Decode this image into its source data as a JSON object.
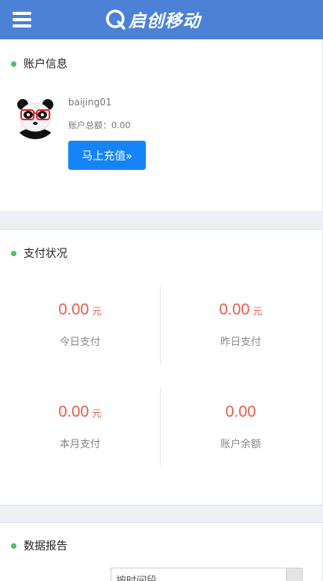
{
  "header": {
    "logo_text": "启创移动",
    "menu_icon": "hamburger-menu-icon",
    "brand_color": "#4c82d6"
  },
  "account": {
    "title": "账户信息",
    "username": "baijing01",
    "balance_text": "账户总额：0.00",
    "recharge_label": "马上充值»",
    "avatar_icon": "panda-avatar-icon"
  },
  "payment": {
    "title": "支付状况",
    "stats": [
      {
        "amount": "0.00",
        "unit": "元",
        "label": "今日支付"
      },
      {
        "amount": "0.00",
        "unit": "元",
        "label": "昨日支付"
      },
      {
        "amount": "0.00",
        "unit": "元",
        "label": "本月支付"
      },
      {
        "amount": "0.00",
        "unit": "",
        "label": "账户余额"
      }
    ],
    "amount_color": "#ea5b4a"
  },
  "report": {
    "title": "数据报告",
    "select_placeholder": "按时间段"
  }
}
